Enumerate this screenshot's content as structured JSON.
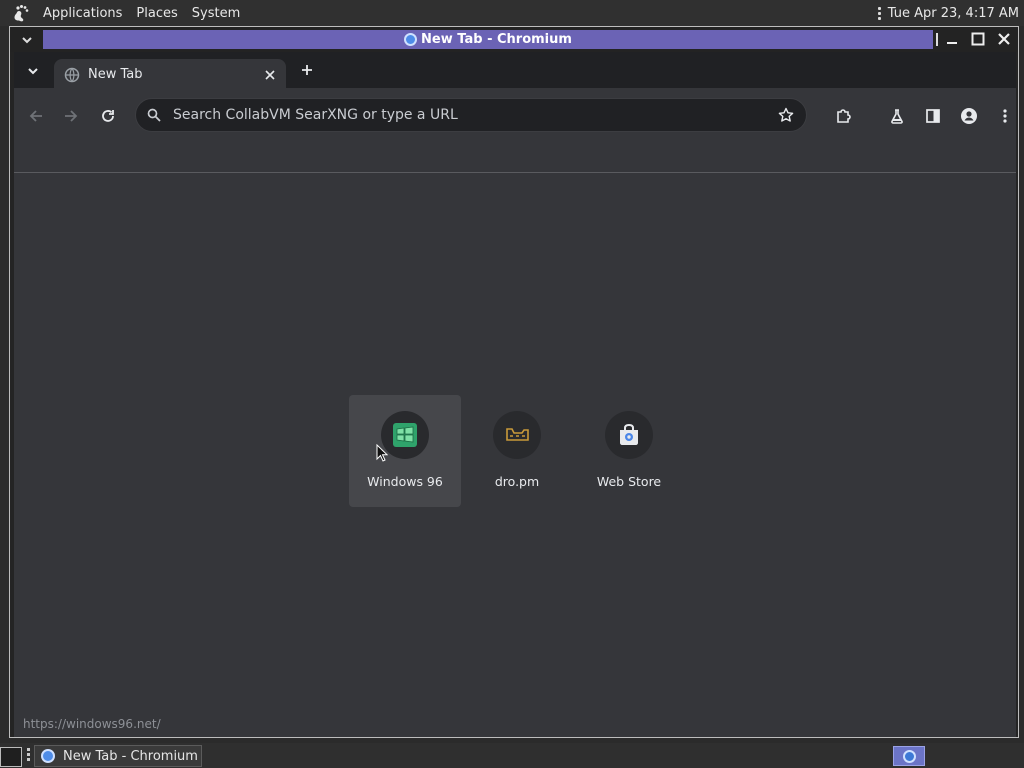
{
  "top_panel": {
    "menus": [
      "Applications",
      "Places",
      "System"
    ],
    "clock": "Tue Apr 23,  4:17 AM"
  },
  "window": {
    "title": "New Tab - Chromium"
  },
  "tabs": [
    {
      "title": "New Tab",
      "active": true
    }
  ],
  "toolbar": {
    "omnibox_placeholder": "Search CollabVM SearXNG or type a URL"
  },
  "shortcuts": [
    {
      "label": "Windows 96",
      "icon": "windows96-icon",
      "hovered": true
    },
    {
      "label": "dro.pm",
      "icon": "dropm-icon",
      "hovered": false
    },
    {
      "label": "Web Store",
      "icon": "web-store-icon",
      "hovered": false
    }
  ],
  "status_bar": {
    "url": "https://windows96.net/"
  },
  "taskbar": {
    "items": [
      "New Tab - Chromium"
    ]
  },
  "colors": {
    "title_active": "#6b63b5",
    "chrome_toolbar": "#35363a",
    "tab_strip": "#202124",
    "omnibox": "#202124",
    "workspace_active": "#6b74c7"
  }
}
